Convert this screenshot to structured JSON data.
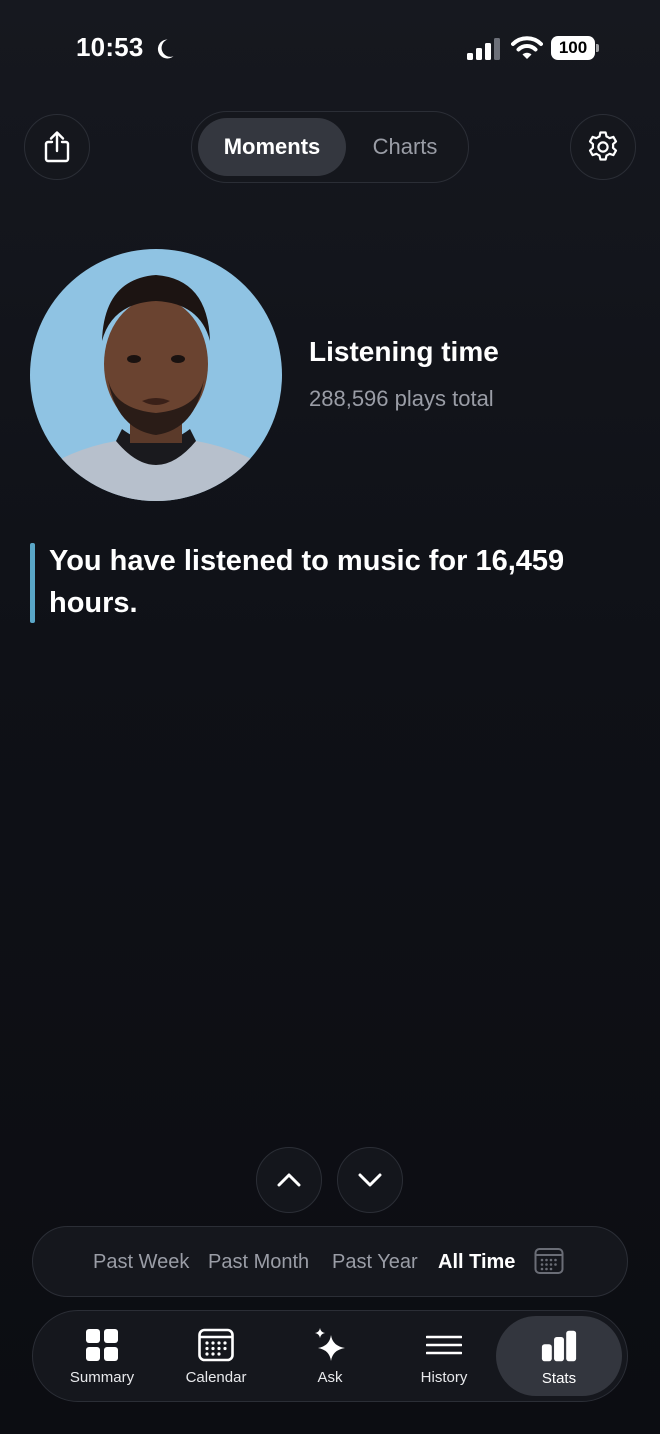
{
  "status_bar": {
    "time": "10:53",
    "battery": "100"
  },
  "header": {
    "segments": [
      {
        "label": "Moments",
        "active": true
      },
      {
        "label": "Charts",
        "active": false
      }
    ]
  },
  "card": {
    "title": "Listening time",
    "subtitle": "288,596 plays total",
    "quote": "You have listened to music for 16,459 hours."
  },
  "time_ranges": [
    {
      "label": "Past Week",
      "active": false
    },
    {
      "label": "Past Month",
      "active": false
    },
    {
      "label": "Past Year",
      "active": false
    },
    {
      "label": "All Time",
      "active": true
    }
  ],
  "tabs": [
    {
      "label": "Summary",
      "icon": "grid-icon"
    },
    {
      "label": "Calendar",
      "icon": "calendar-icon"
    },
    {
      "label": "Ask",
      "icon": "sparkle-icon"
    },
    {
      "label": "History",
      "icon": "list-icon"
    },
    {
      "label": "Stats",
      "icon": "bar-chart-icon",
      "active": true
    }
  ],
  "colors": {
    "background": "#0f1117",
    "accent": "#5aa6c7",
    "muted_text": "#9a9da6",
    "photo_background": "#8fc3e3"
  }
}
